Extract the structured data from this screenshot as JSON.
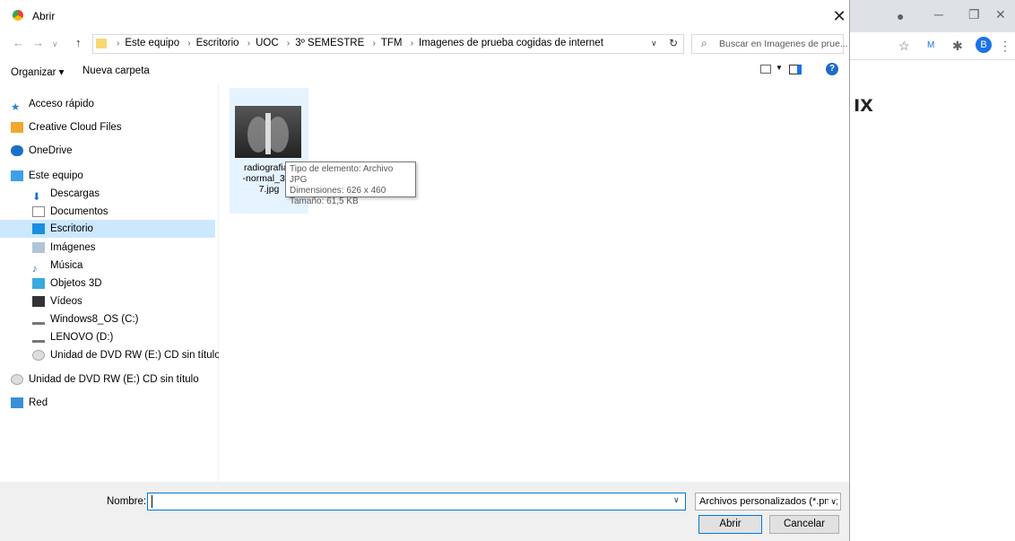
{
  "browser": {
    "bg_heading_fragment": "ıx",
    "avatar_letter": "B"
  },
  "dialog": {
    "title": "Abrir",
    "breadcrumbs": [
      "Este equipo",
      "Escritorio",
      "UOC",
      "3º SEMESTRE",
      "TFM",
      "Imagenes de prueba cogidas de internet"
    ],
    "search_placeholder": "Buscar en Imagenes de prue...",
    "toolbar": {
      "organize": "Organizar ▾",
      "new_folder": "Nueva carpeta"
    },
    "nav": [
      {
        "label": "Acceso rápido"
      },
      {
        "label": "Creative Cloud Files"
      },
      {
        "label": "OneDrive"
      },
      {
        "label": "Este equipo"
      },
      {
        "label": "Descargas"
      },
      {
        "label": "Documentos"
      },
      {
        "label": "Escritorio"
      },
      {
        "label": "Imágenes"
      },
      {
        "label": "Música"
      },
      {
        "label": "Objetos 3D"
      },
      {
        "label": "Vídeos"
      },
      {
        "label": "Windows8_OS (C:)"
      },
      {
        "label": "LENOVO (D:)"
      },
      {
        "label": "Unidad de DVD RW (E:) CD sin título"
      },
      {
        "label": "Unidad de DVD RW (E:) CD sin título"
      },
      {
        "label": "Red"
      }
    ],
    "file": {
      "name_lines": [
        "radiografia-t",
        "-normal_342",
        "7.jpg"
      ],
      "tooltip": [
        "Tipo de elemento: Archivo JPG",
        "Dimensiones: 626 x 460",
        "Tamaño: 61,5 KB"
      ]
    },
    "bottom": {
      "name_label": "Nombre:",
      "name_value": "",
      "filter": "Archivos personalizados (*.png;",
      "open": "Abrir",
      "cancel": "Cancelar"
    }
  }
}
